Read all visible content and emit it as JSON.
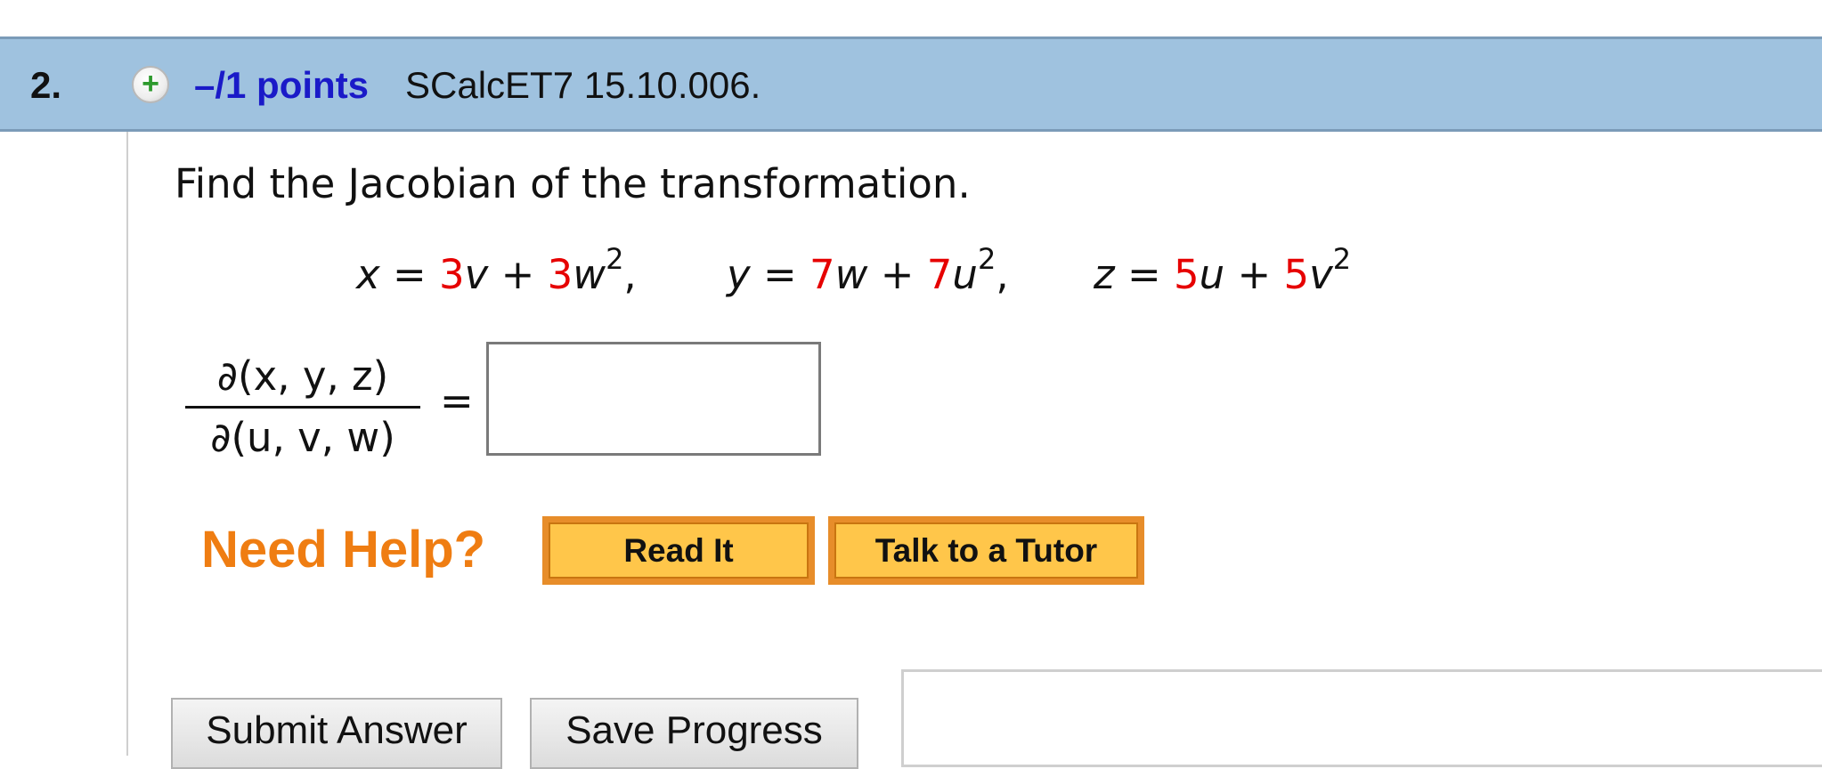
{
  "header": {
    "question_number": "2.",
    "expand_symbol": "+",
    "points_label": "–/1 points",
    "source_label": "SCalcET7 15.10.006.",
    "colors": {
      "background": "#9fc2df",
      "points": "#1a1ac8"
    }
  },
  "question": {
    "prompt": "Find the Jacobian of the transformation.",
    "equations": {
      "x": {
        "var": "x",
        "eq": "=",
        "c1": "3",
        "t1": "v",
        "plus": "+",
        "c2": "3",
        "t2": "w",
        "exp": "2",
        "sep": ","
      },
      "y": {
        "var": "y",
        "eq": "=",
        "c1": "7",
        "t1": "w",
        "plus": "+",
        "c2": "7",
        "t2": "u",
        "exp": "2",
        "sep": ","
      },
      "z": {
        "var": "z",
        "eq": "=",
        "c1": "5",
        "t1": "u",
        "plus": "+",
        "c2": "5",
        "t2": "v",
        "exp": "2"
      }
    },
    "jacobian": {
      "numerator": "∂(x, y, z)",
      "denominator": "∂(u, v, w)",
      "equals": "="
    },
    "answer_value": "",
    "colors": {
      "coefficient": "#e60000"
    }
  },
  "help": {
    "label": "Need Help?",
    "read_it": "Read It",
    "tutor": "Talk to a Tutor",
    "colors": {
      "label": "#ef7d12",
      "button_fill": "#ffc64a",
      "button_border": "#e78d2a"
    }
  },
  "actions": {
    "submit": "Submit Answer",
    "save": "Save Progress"
  },
  "icons": {
    "expand": "plus-circle-icon"
  }
}
